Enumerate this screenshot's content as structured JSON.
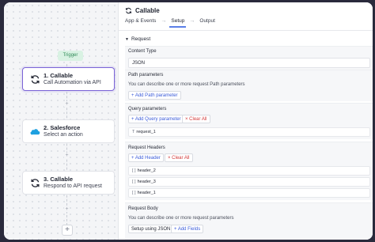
{
  "canvas": {
    "trigger_label": "Trigger",
    "nodes": [
      {
        "title": "1. Callable",
        "subtitle": "Call Automation via API",
        "icon": "sync-icon"
      },
      {
        "title": "2. Salesforce",
        "subtitle": "Select an action",
        "icon": "salesforce-cloud-icon"
      },
      {
        "title": "3. Callable",
        "subtitle": "Respond to API request",
        "icon": "sync-icon"
      }
    ],
    "plus_glyph": "+",
    "colors": {
      "active_border": "#7a63d6",
      "trigger_bg": "#d9f2e3",
      "salesforce_blue": "#1ea0e0"
    }
  },
  "panel": {
    "title": "Callable",
    "steps": [
      {
        "label": "App & Events"
      },
      {
        "label": "Setup",
        "active": true
      },
      {
        "label": "Output"
      }
    ],
    "arrow": "→",
    "section": "Request",
    "content_type": {
      "label": "Content Type",
      "value": "JSON"
    },
    "path_params": {
      "label": "Path parameters",
      "hint": "You can describe one or more request Path parameters",
      "add_button": "Add Path parameter"
    },
    "query_params": {
      "label": "Query parameters",
      "add_button": "Add Query parameter",
      "clear_button": "Clear All",
      "items": [
        "request_1"
      ]
    },
    "headers": {
      "label": "Request Headers",
      "add_button": "Add Header",
      "clear_button": "Clear All",
      "items": [
        "header_2",
        "header_3",
        "header_1"
      ]
    },
    "body": {
      "label": "Request Body",
      "hint": "You can describe one or more request parameters",
      "json_button": "Setup using JSON",
      "fields_button": "Add Fields"
    },
    "colors": {
      "accent": "#5b7fe8",
      "add": "#3a5bd9",
      "clear": "#d23a3a"
    }
  }
}
